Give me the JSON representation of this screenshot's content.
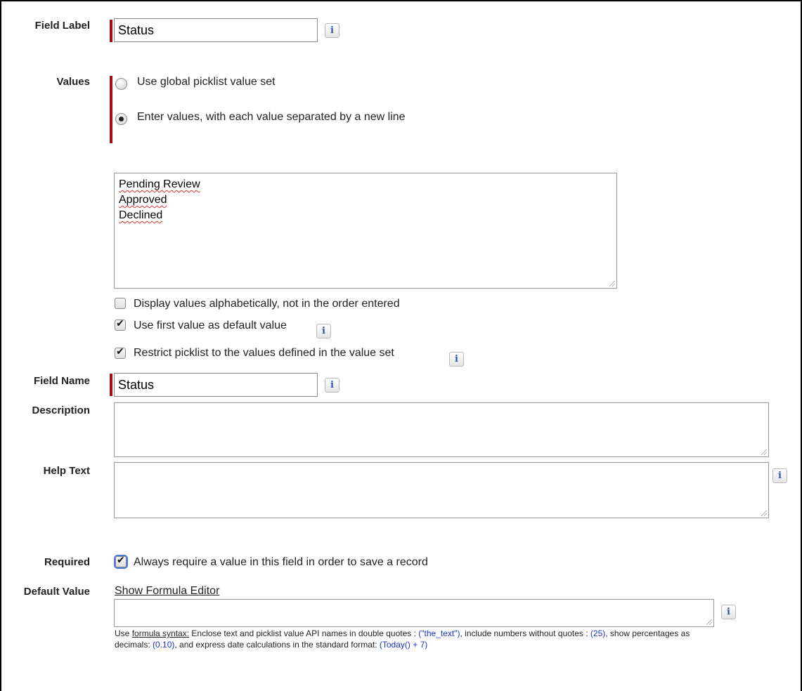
{
  "field_label": {
    "label": "Field Label",
    "value": "Status"
  },
  "values": {
    "label": "Values",
    "options": [
      {
        "label": "Use global picklist value set",
        "selected": false
      },
      {
        "label": "Enter values, with each value separated by a new line",
        "selected": true
      }
    ],
    "entries": [
      "Pending Review",
      "Approved",
      "Declined"
    ],
    "checkboxes": [
      {
        "label": "Display values alphabetically, not in the order entered",
        "checked": false
      },
      {
        "label": "Use first value as default value",
        "checked": true
      },
      {
        "label": "Restrict picklist to the values defined in the value set",
        "checked": true
      }
    ]
  },
  "field_name": {
    "label": "Field Name",
    "value": "Status"
  },
  "description": {
    "label": "Description",
    "value": ""
  },
  "help_text": {
    "label": "Help Text",
    "value": ""
  },
  "required": {
    "label": "Required",
    "option": "Always require a value in this field in order to save a record",
    "checked": true
  },
  "default_value": {
    "label": "Default Value",
    "link": "Show Formula Editor",
    "value": "",
    "hint": {
      "prefix": "Use ",
      "syntax_link": "formula syntax:",
      "t1": " Enclose text and picklist value API names in double quotes : ",
      "ex1": "(\"the_text\")",
      "t2": ", include numbers without quotes : ",
      "ex2": "(25)",
      "t3": ", show percentages as decimals: ",
      "ex3": "(0.10)",
      "t4": ", and express date calculations in the standard format: ",
      "ex4": "(Today() + 7)"
    }
  },
  "info_glyph": "i",
  "colors": {
    "required_bar": "#a50d10",
    "link_blue": "#1b30d6",
    "info_icon": "#2a56b3"
  }
}
